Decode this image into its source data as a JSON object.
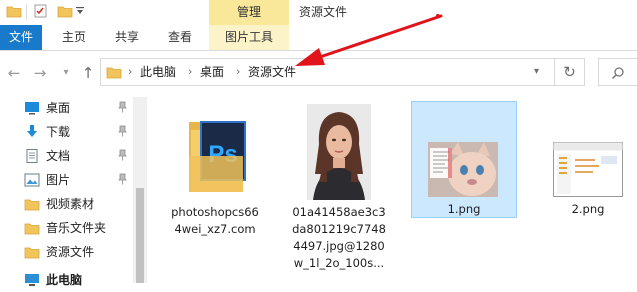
{
  "titlebar": {
    "manage_tab": "管理",
    "window_title": "资源文件"
  },
  "ribbon": {
    "tabs": [
      "文件",
      "主页",
      "共享",
      "查看"
    ],
    "contextual_tab": "图片工具"
  },
  "address": {
    "crumbs": [
      "此电脑",
      "桌面",
      "资源文件"
    ]
  },
  "sidebar": {
    "items": [
      {
        "label": "桌面",
        "icon": "desktop-icon",
        "pinned": true
      },
      {
        "label": "下载",
        "icon": "download-icon",
        "pinned": true
      },
      {
        "label": "文档",
        "icon": "document-icon",
        "pinned": true
      },
      {
        "label": "图片",
        "icon": "picture-icon",
        "pinned": true
      },
      {
        "label": "视频素材",
        "icon": "folder-icon",
        "pinned": false
      },
      {
        "label": "音乐文件夹",
        "icon": "folder-icon",
        "pinned": false
      },
      {
        "label": "资源文件",
        "icon": "folder-icon",
        "pinned": false
      },
      {
        "label": "此电脑",
        "icon": "pc-icon",
        "pinned": false
      }
    ]
  },
  "files": [
    {
      "name": "photoshopcs664wei_xz7.com",
      "lines": [
        "photoshopcs66",
        "4wei_xz7.com"
      ],
      "type": "photoshop-folder"
    },
    {
      "name": "01a41458ae3c3da801219c77484497.jpg@1280w_1l_2o_100s...",
      "lines": [
        "01a41458ae3c3",
        "da801219c7748",
        "4497.jpg@1280",
        "w_1l_2o_100s..."
      ],
      "type": "portrait-image"
    },
    {
      "name": "1.png",
      "lines": [
        "1.png"
      ],
      "type": "png-cat",
      "selected": true
    },
    {
      "name": "2.png",
      "lines": [
        "2.png"
      ],
      "type": "png-screenshot"
    }
  ],
  "colors": {
    "file_tab": "#1979ca",
    "manage_tab": "#f9e79a",
    "selection": "#cce8ff",
    "arrow": "#e0141a"
  }
}
